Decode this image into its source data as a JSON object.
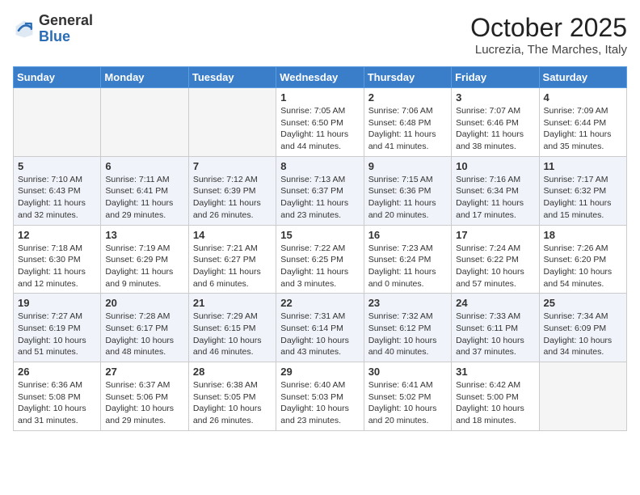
{
  "header": {
    "logo_general": "General",
    "logo_blue": "Blue",
    "month_title": "October 2025",
    "location": "Lucrezia, The Marches, Italy"
  },
  "days_of_week": [
    "Sunday",
    "Monday",
    "Tuesday",
    "Wednesday",
    "Thursday",
    "Friday",
    "Saturday"
  ],
  "weeks": [
    [
      {
        "day": "",
        "info": ""
      },
      {
        "day": "",
        "info": ""
      },
      {
        "day": "",
        "info": ""
      },
      {
        "day": "1",
        "info": "Sunrise: 7:05 AM\nSunset: 6:50 PM\nDaylight: 11 hours and 44 minutes."
      },
      {
        "day": "2",
        "info": "Sunrise: 7:06 AM\nSunset: 6:48 PM\nDaylight: 11 hours and 41 minutes."
      },
      {
        "day": "3",
        "info": "Sunrise: 7:07 AM\nSunset: 6:46 PM\nDaylight: 11 hours and 38 minutes."
      },
      {
        "day": "4",
        "info": "Sunrise: 7:09 AM\nSunset: 6:44 PM\nDaylight: 11 hours and 35 minutes."
      }
    ],
    [
      {
        "day": "5",
        "info": "Sunrise: 7:10 AM\nSunset: 6:43 PM\nDaylight: 11 hours and 32 minutes."
      },
      {
        "day": "6",
        "info": "Sunrise: 7:11 AM\nSunset: 6:41 PM\nDaylight: 11 hours and 29 minutes."
      },
      {
        "day": "7",
        "info": "Sunrise: 7:12 AM\nSunset: 6:39 PM\nDaylight: 11 hours and 26 minutes."
      },
      {
        "day": "8",
        "info": "Sunrise: 7:13 AM\nSunset: 6:37 PM\nDaylight: 11 hours and 23 minutes."
      },
      {
        "day": "9",
        "info": "Sunrise: 7:15 AM\nSunset: 6:36 PM\nDaylight: 11 hours and 20 minutes."
      },
      {
        "day": "10",
        "info": "Sunrise: 7:16 AM\nSunset: 6:34 PM\nDaylight: 11 hours and 17 minutes."
      },
      {
        "day": "11",
        "info": "Sunrise: 7:17 AM\nSunset: 6:32 PM\nDaylight: 11 hours and 15 minutes."
      }
    ],
    [
      {
        "day": "12",
        "info": "Sunrise: 7:18 AM\nSunset: 6:30 PM\nDaylight: 11 hours and 12 minutes."
      },
      {
        "day": "13",
        "info": "Sunrise: 7:19 AM\nSunset: 6:29 PM\nDaylight: 11 hours and 9 minutes."
      },
      {
        "day": "14",
        "info": "Sunrise: 7:21 AM\nSunset: 6:27 PM\nDaylight: 11 hours and 6 minutes."
      },
      {
        "day": "15",
        "info": "Sunrise: 7:22 AM\nSunset: 6:25 PM\nDaylight: 11 hours and 3 minutes."
      },
      {
        "day": "16",
        "info": "Sunrise: 7:23 AM\nSunset: 6:24 PM\nDaylight: 11 hours and 0 minutes."
      },
      {
        "day": "17",
        "info": "Sunrise: 7:24 AM\nSunset: 6:22 PM\nDaylight: 10 hours and 57 minutes."
      },
      {
        "day": "18",
        "info": "Sunrise: 7:26 AM\nSunset: 6:20 PM\nDaylight: 10 hours and 54 minutes."
      }
    ],
    [
      {
        "day": "19",
        "info": "Sunrise: 7:27 AM\nSunset: 6:19 PM\nDaylight: 10 hours and 51 minutes."
      },
      {
        "day": "20",
        "info": "Sunrise: 7:28 AM\nSunset: 6:17 PM\nDaylight: 10 hours and 48 minutes."
      },
      {
        "day": "21",
        "info": "Sunrise: 7:29 AM\nSunset: 6:15 PM\nDaylight: 10 hours and 46 minutes."
      },
      {
        "day": "22",
        "info": "Sunrise: 7:31 AM\nSunset: 6:14 PM\nDaylight: 10 hours and 43 minutes."
      },
      {
        "day": "23",
        "info": "Sunrise: 7:32 AM\nSunset: 6:12 PM\nDaylight: 10 hours and 40 minutes."
      },
      {
        "day": "24",
        "info": "Sunrise: 7:33 AM\nSunset: 6:11 PM\nDaylight: 10 hours and 37 minutes."
      },
      {
        "day": "25",
        "info": "Sunrise: 7:34 AM\nSunset: 6:09 PM\nDaylight: 10 hours and 34 minutes."
      }
    ],
    [
      {
        "day": "26",
        "info": "Sunrise: 6:36 AM\nSunset: 5:08 PM\nDaylight: 10 hours and 31 minutes."
      },
      {
        "day": "27",
        "info": "Sunrise: 6:37 AM\nSunset: 5:06 PM\nDaylight: 10 hours and 29 minutes."
      },
      {
        "day": "28",
        "info": "Sunrise: 6:38 AM\nSunset: 5:05 PM\nDaylight: 10 hours and 26 minutes."
      },
      {
        "day": "29",
        "info": "Sunrise: 6:40 AM\nSunset: 5:03 PM\nDaylight: 10 hours and 23 minutes."
      },
      {
        "day": "30",
        "info": "Sunrise: 6:41 AM\nSunset: 5:02 PM\nDaylight: 10 hours and 20 minutes."
      },
      {
        "day": "31",
        "info": "Sunrise: 6:42 AM\nSunset: 5:00 PM\nDaylight: 10 hours and 18 minutes."
      },
      {
        "day": "",
        "info": ""
      }
    ]
  ]
}
